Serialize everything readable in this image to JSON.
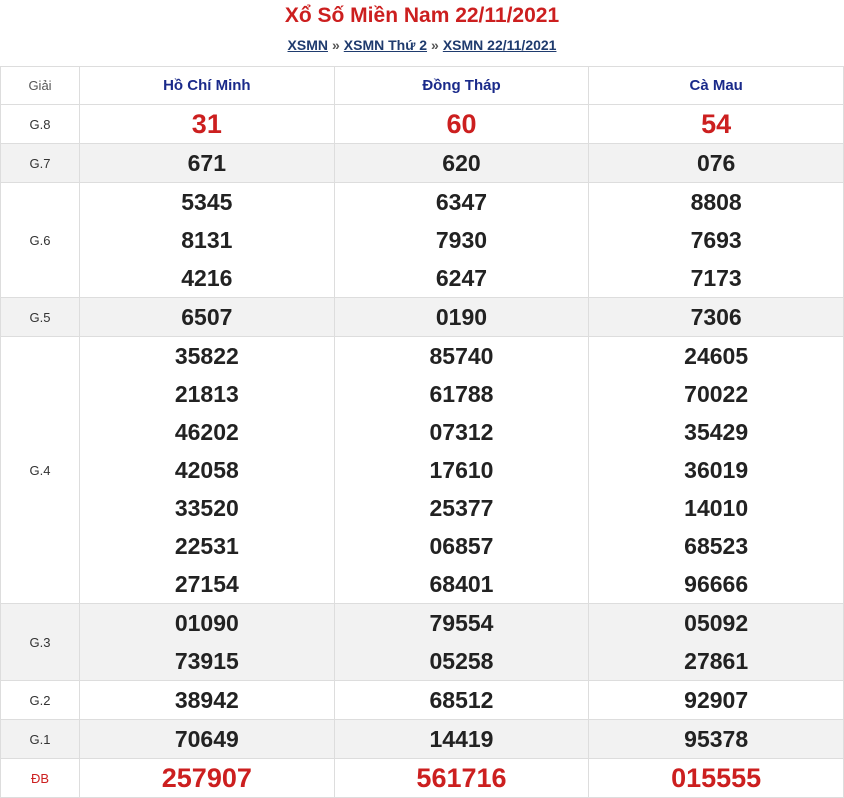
{
  "header": {
    "title": "Xổ Số Miền Nam 22/11/2021",
    "crumb1": "XSMN",
    "sep": "»",
    "crumb2": "XSMN Thứ 2",
    "crumb3": "XSMN 22/11/2021"
  },
  "table": {
    "giai_label": "Giải",
    "provinces": [
      "Hồ Chí Minh",
      "Đồng Tháp",
      "Cà Mau"
    ],
    "rows": [
      {
        "label": "G.8",
        "red": true,
        "shade": false,
        "cols": [
          [
            "31"
          ],
          [
            "60"
          ],
          [
            "54"
          ]
        ]
      },
      {
        "label": "G.7",
        "red": false,
        "shade": true,
        "cols": [
          [
            "671"
          ],
          [
            "620"
          ],
          [
            "076"
          ]
        ]
      },
      {
        "label": "G.6",
        "red": false,
        "shade": false,
        "cols": [
          [
            "5345",
            "8131",
            "4216"
          ],
          [
            "6347",
            "7930",
            "6247"
          ],
          [
            "8808",
            "7693",
            "7173"
          ]
        ]
      },
      {
        "label": "G.5",
        "red": false,
        "shade": true,
        "cols": [
          [
            "6507"
          ],
          [
            "0190"
          ],
          [
            "7306"
          ]
        ]
      },
      {
        "label": "G.4",
        "red": false,
        "shade": false,
        "cols": [
          [
            "35822",
            "21813",
            "46202",
            "42058",
            "33520",
            "22531",
            "27154"
          ],
          [
            "85740",
            "61788",
            "07312",
            "17610",
            "25377",
            "06857",
            "68401"
          ],
          [
            "24605",
            "70022",
            "35429",
            "36019",
            "14010",
            "68523",
            "96666"
          ]
        ]
      },
      {
        "label": "G.3",
        "red": false,
        "shade": true,
        "cols": [
          [
            "01090",
            "73915"
          ],
          [
            "79554",
            "05258"
          ],
          [
            "05092",
            "27861"
          ]
        ]
      },
      {
        "label": "G.2",
        "red": false,
        "shade": false,
        "cols": [
          [
            "38942"
          ],
          [
            "68512"
          ],
          [
            "92907"
          ]
        ]
      },
      {
        "label": "G.1",
        "red": false,
        "shade": true,
        "cols": [
          [
            "70649"
          ],
          [
            "14419"
          ],
          [
            "95378"
          ]
        ]
      },
      {
        "label": "ĐB",
        "red": true,
        "shade": false,
        "cols": [
          [
            "257907"
          ],
          [
            "561716"
          ],
          [
            "015555"
          ]
        ]
      }
    ]
  },
  "colors": {
    "title": "#cc1f1f",
    "link": "#1f3b6e",
    "province": "#1a2a8a",
    "shade": "#f2f2f2"
  }
}
